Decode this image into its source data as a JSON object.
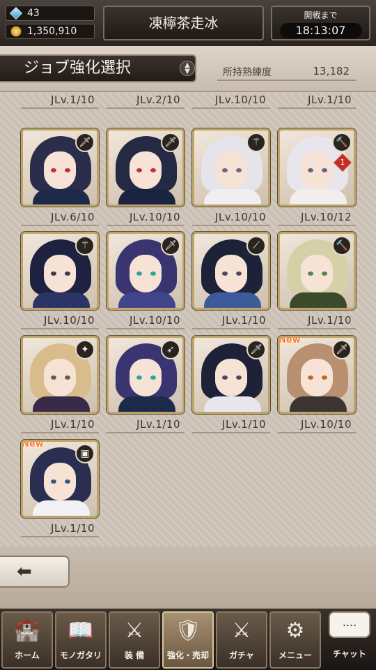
{
  "status": {
    "crystals": "43",
    "gold": "1,350,910",
    "player_name": "凍檸茶走冰",
    "timer_label": "開戦まで",
    "timer_value": "18:13:07"
  },
  "header": {
    "title": "ジョブ強化選択",
    "mastery_label": "所持熟練度",
    "mastery_value": "13,182"
  },
  "partial_row": [
    "JLv.1/10",
    "JLv.2/10",
    "JLv.10/10",
    "JLv.1/10"
  ],
  "jobs": [
    {
      "level": "JLv.6/10",
      "weapon": "sword-icon",
      "glyph": "🗡",
      "hair": "#2a2e4a",
      "eye": "#c03030",
      "body": "#1e2a4a"
    },
    {
      "level": "JLv.10/10",
      "weapon": "sword-icon",
      "glyph": "🗡",
      "hair": "#252a44",
      "eye": "#c03030",
      "body": "#1a2440"
    },
    {
      "level": "JLv.10/10",
      "weapon": "staff-icon",
      "glyph": "⚚",
      "hair": "#e4e4ea",
      "eye": "#6a6a7a",
      "body": "#f0eef0"
    },
    {
      "level": "JLv.10/12",
      "weapon": "hammer-icon",
      "glyph": "🔨",
      "hair": "#e6e6ec",
      "eye": "#5a6a7a",
      "body": "#f2eeee",
      "badge": "1"
    },
    {
      "level": "JLv.10/10",
      "weapon": "staff-icon",
      "glyph": "⚚",
      "hair": "#1e2240",
      "eye": "#3a3a4a",
      "body": "#2a3466"
    },
    {
      "level": "JLv.10/10",
      "weapon": "sword-icon",
      "glyph": "🗡",
      "hair": "#3a3470",
      "eye": "#2aa6a0",
      "body": "#40448a"
    },
    {
      "level": "JLv.1/10",
      "weapon": "spear-icon",
      "glyph": "⟋",
      "hair": "#1e2238",
      "eye": "#4a4a5a",
      "body": "#3a5a9a"
    },
    {
      "level": "JLv.1/10",
      "weapon": "hammer-icon",
      "glyph": "🔨",
      "hair": "#d6d0a8",
      "eye": "#4a8a4a",
      "body": "#3a4a2a"
    },
    {
      "level": "JLv.1/10",
      "weapon": "book-icon",
      "glyph": "✦",
      "hair": "#d8bc8c",
      "eye": "#6a5a4a",
      "body": "#3a2a4a"
    },
    {
      "level": "JLv.1/10",
      "weapon": "bow-icon",
      "glyph": "➶",
      "hair": "#3a3470",
      "eye": "#2aa6a0",
      "body": "#1e2a4a"
    },
    {
      "level": "JLv.1/10",
      "weapon": "sword-icon",
      "glyph": "🗡",
      "hair": "#1e2238",
      "eye": "#4a4a5a",
      "body": "#eae6ee"
    },
    {
      "level": "JLv.10/10",
      "weapon": "sword-icon",
      "glyph": "🗡",
      "hair": "#b89070",
      "eye": "#c06a20",
      "body": "#3a3432",
      "new": "New"
    },
    {
      "level": "JLv.1/10",
      "weapon": "tome-icon",
      "glyph": "▣",
      "hair": "#2a2e50",
      "eye": "#3a5a7a",
      "body": "#f2f2f6",
      "new": "New"
    }
  ],
  "nav": [
    {
      "label": "ホーム",
      "glyph": "🏰",
      "icon": "castle-icon"
    },
    {
      "label": "モノガタリ",
      "glyph": "📖",
      "icon": "book-icon"
    },
    {
      "label": "装 備",
      "glyph": "⚔",
      "icon": "equipment-icon"
    },
    {
      "label": "強化・売却",
      "glyph": "🛡",
      "icon": "enhance-icon",
      "active": true
    },
    {
      "label": "ガチャ",
      "glyph": "⚔",
      "icon": "gacha-icon"
    },
    {
      "label": "メニュー",
      "glyph": "⚙",
      "icon": "gear-icon"
    }
  ],
  "chat": {
    "bubble": "....",
    "label": "チャット"
  }
}
